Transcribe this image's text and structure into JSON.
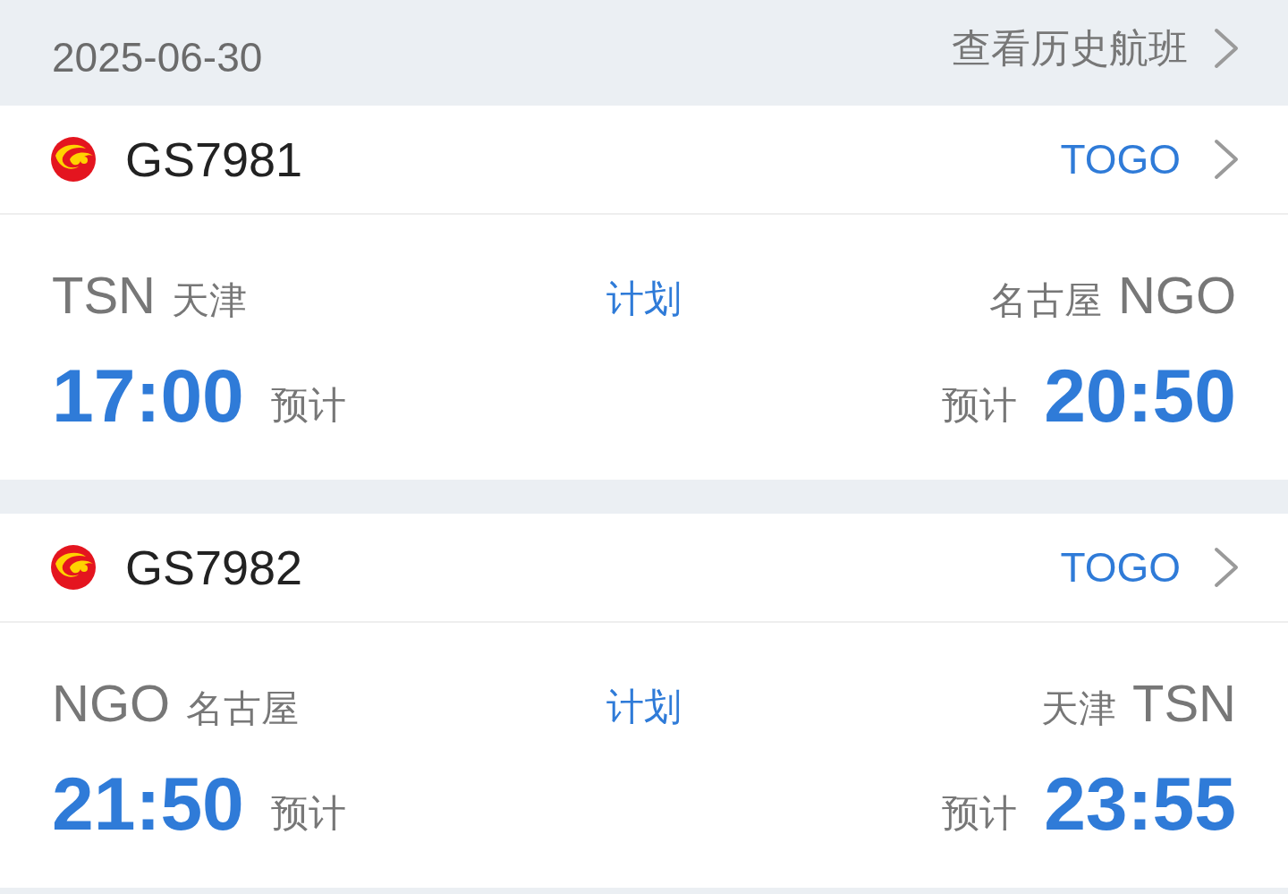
{
  "date": "2025-06-30",
  "history_link": "查看历史航班",
  "flights": [
    {
      "flight_no": "GS7981",
      "operator": "TOGO",
      "status": "计划",
      "origin": {
        "code": "TSN",
        "city": "天津"
      },
      "destination": {
        "city": "名古屋",
        "code": "NGO"
      },
      "departure": {
        "time": "17:00",
        "label": "预计"
      },
      "arrival": {
        "label": "预计",
        "time": "20:50"
      }
    },
    {
      "flight_no": "GS7982",
      "operator": "TOGO",
      "status": "计划",
      "origin": {
        "code": "NGO",
        "city": "名古屋"
      },
      "destination": {
        "city": "天津",
        "code": "TSN"
      },
      "departure": {
        "time": "21:50",
        "label": "预计"
      },
      "arrival": {
        "label": "预计",
        "time": "23:55"
      }
    }
  ]
}
